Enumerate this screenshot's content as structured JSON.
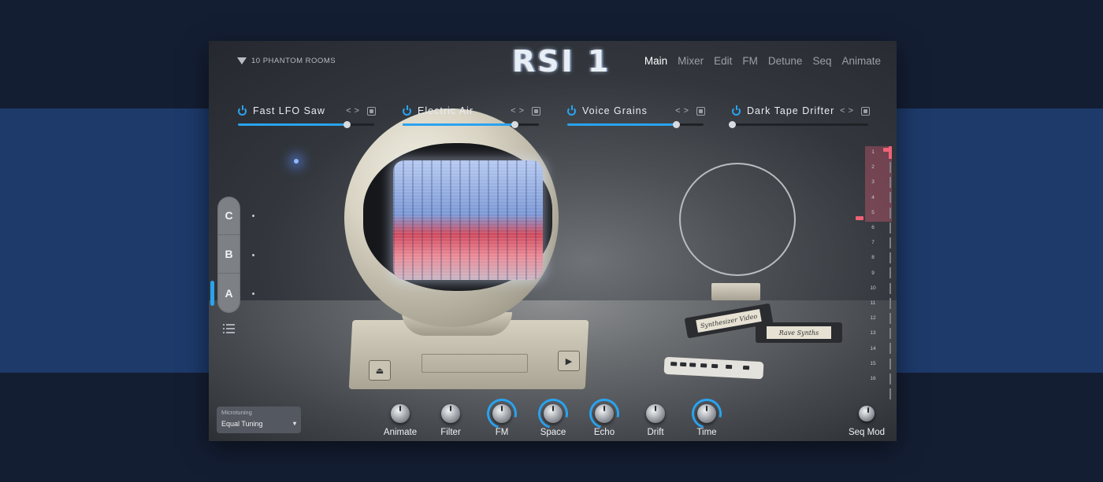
{
  "brand": {
    "logo_text": "10 PHANTOM ROOMS",
    "title": "RSI 1"
  },
  "nav": {
    "tabs": [
      "Main",
      "Mixer",
      "Edit",
      "FM",
      "Detune",
      "Seq",
      "Animate"
    ],
    "active": "Main"
  },
  "effects": [
    {
      "name": "Fast LFO Saw",
      "value_fraction": 0.8
    },
    {
      "name": "Electric Air",
      "value_fraction": 0.82
    },
    {
      "name": "Voice Grains",
      "value_fraction": 0.8
    },
    {
      "name": "Dark Tape Drifter",
      "value_fraction": 0.0
    }
  ],
  "layers": {
    "items": [
      "C",
      "B",
      "A"
    ],
    "active": "A"
  },
  "tapes": {
    "tape1_label": "Synthesizer Video",
    "tape2_label": "Rave Synths"
  },
  "sequencer": {
    "steps": [
      "1",
      "2",
      "3",
      "4",
      "5",
      "6",
      "7",
      "8",
      "9",
      "10",
      "11",
      "12",
      "13",
      "14",
      "15",
      "16"
    ],
    "loop_start": 1,
    "loop_end": 5,
    "accent_color": "#f06278"
  },
  "microtuning": {
    "label": "Microtuning",
    "value": "Equal Tuning"
  },
  "knobs": [
    {
      "label": "Animate",
      "active": false
    },
    {
      "label": "Filter",
      "active": false
    },
    {
      "label": "FM",
      "active": true
    },
    {
      "label": "Space",
      "active": true
    },
    {
      "label": "Echo",
      "active": true
    },
    {
      "label": "Drift",
      "active": false
    },
    {
      "label": "Time",
      "active": true
    }
  ],
  "seq_mod": {
    "label": "Seq Mod"
  },
  "colors": {
    "accent": "#2aa3ef",
    "background": "#141e33",
    "band": "#1d3a6a"
  }
}
